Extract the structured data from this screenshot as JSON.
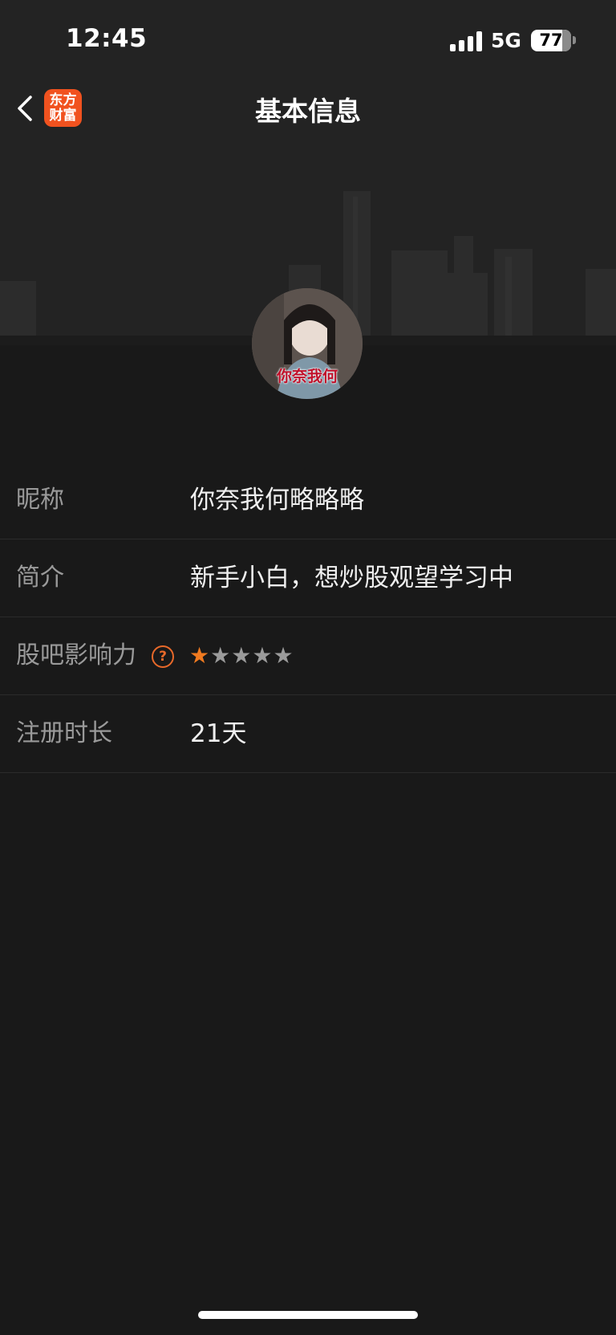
{
  "status_bar": {
    "time": "12:45",
    "network": "5G",
    "battery": "77"
  },
  "nav": {
    "back_icon": "chevron-left-icon",
    "logo_text": [
      "东方",
      "财富"
    ],
    "title": "基本信息"
  },
  "avatar": {
    "caption": "你奈我何"
  },
  "info": {
    "nickname": {
      "label": "昵称",
      "value": "你奈我何略略略"
    },
    "bio": {
      "label": "简介",
      "value": "新手小白，想炒股观望学习中"
    },
    "influence": {
      "label": "股吧影响力",
      "help_icon": "?",
      "rating": 1,
      "max_rating": 5
    },
    "registration": {
      "label": "注册时长",
      "value": "21天"
    }
  },
  "colors": {
    "accent": "#f07a20",
    "logo": "#f1521f",
    "background": "#191919"
  }
}
